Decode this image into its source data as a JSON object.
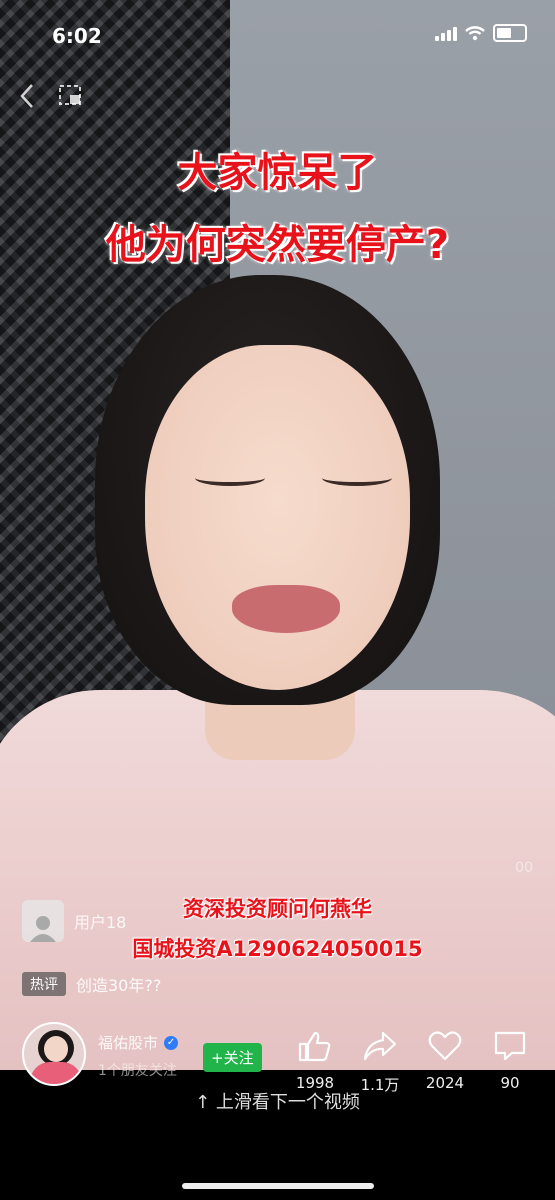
{
  "status_bar": {
    "time": "6:02"
  },
  "video": {
    "headline_line1": "大家惊呆了",
    "headline_line2": "他为何突然要停产?",
    "caption_line1": "资深投资顾问何燕华",
    "caption_line2": "国城投资A1290624050015",
    "faint_number": "00"
  },
  "comment": {
    "username": "用户18",
    "hot_badge": "热评",
    "hot_text": "创造30年??"
  },
  "author": {
    "name": "福佑股市",
    "friends_note": "1个朋友关注",
    "follow_label": "+关注"
  },
  "actions": {
    "like_count": "1998",
    "share_count": "1.1万",
    "favorite_count": "2024",
    "comment_count": "90"
  },
  "footer": {
    "swipe_hint": "↑ 上滑看下一个视频"
  },
  "colors": {
    "headline_red": "#e8121b",
    "follow_green": "#21b44b"
  }
}
